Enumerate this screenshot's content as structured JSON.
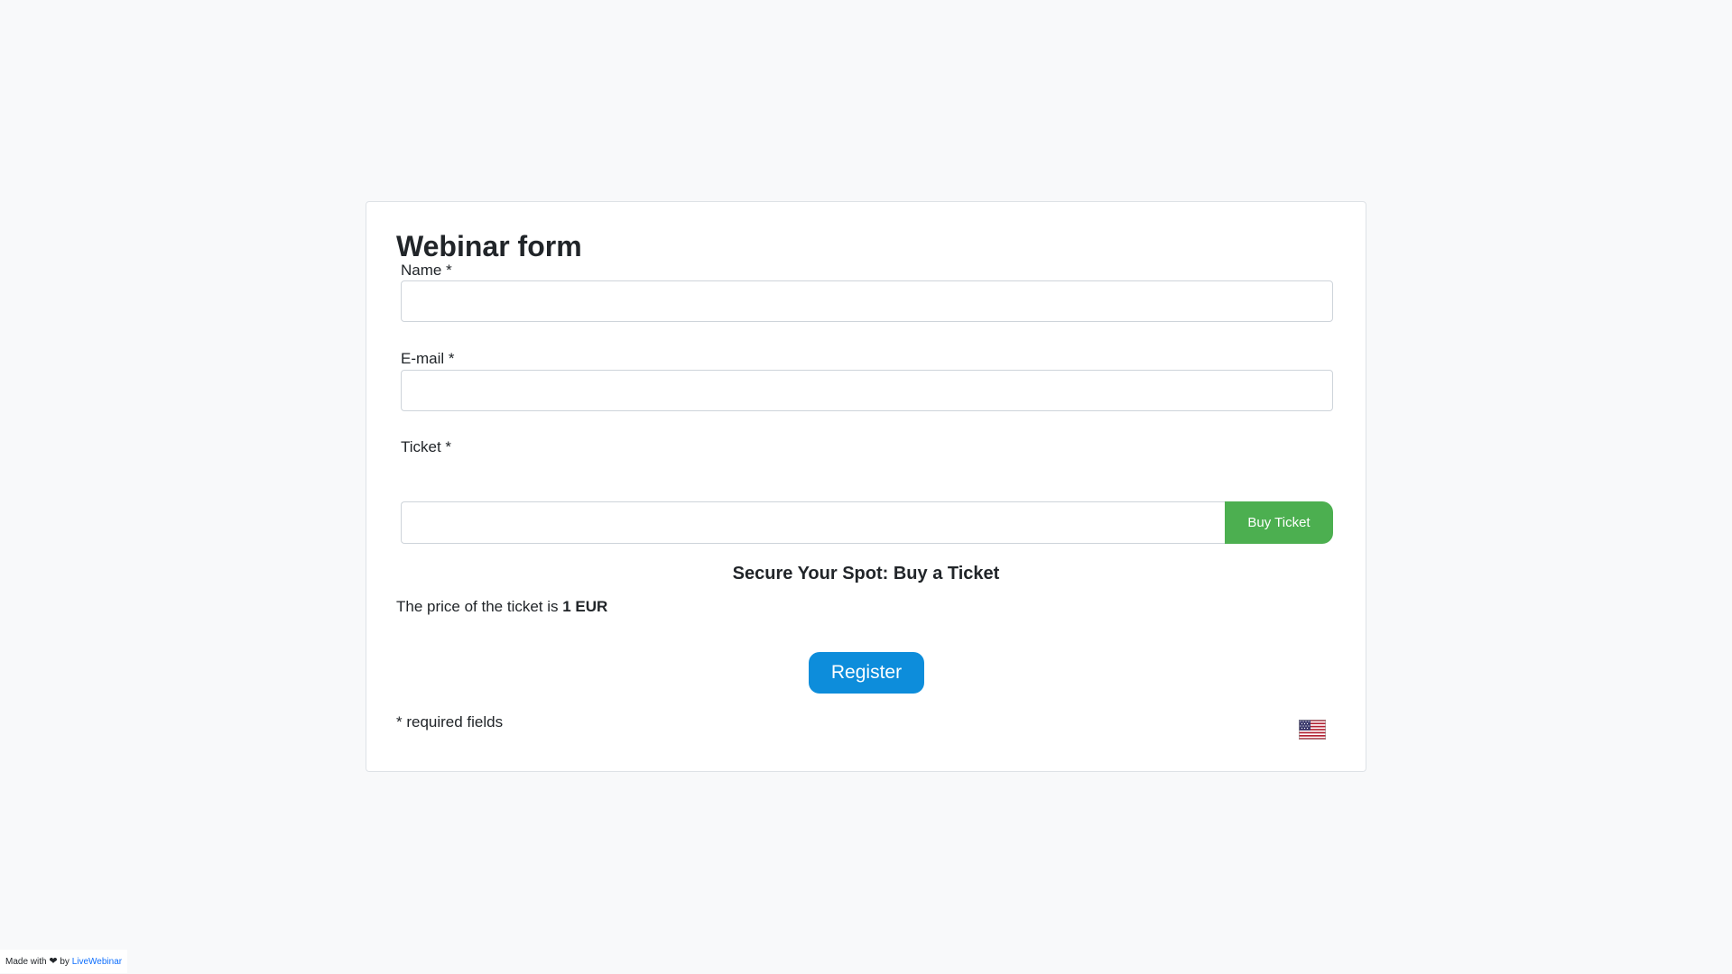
{
  "form": {
    "title": "Webinar form",
    "name_label": "Name *",
    "name_value": "",
    "email_label": "E-mail *",
    "email_value": "",
    "ticket_label": "Ticket *",
    "ticket_value": "",
    "buy_ticket_label": "Buy Ticket",
    "secure_heading": "Secure Your Spot: Buy a Ticket",
    "price_prefix": "The price of the ticket is ",
    "price_value": "1 EUR",
    "register_label": "Register",
    "required_note": "* required fields",
    "language_icon": "us-flag-icon"
  },
  "footer": {
    "made_with": "Made with",
    "by": "by",
    "brand_link": "LiveWebinar"
  },
  "colors": {
    "background": "#f8f9fa",
    "buy_button": "#4caf50",
    "register_button": "#0d8ddb",
    "link": "#0d6efd"
  }
}
